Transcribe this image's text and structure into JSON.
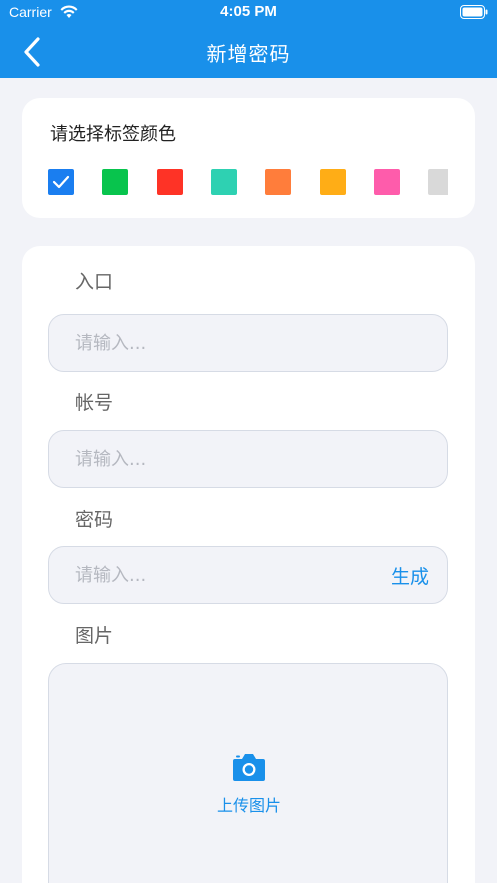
{
  "status_bar": {
    "carrier": "Carrier",
    "time": "4:05 PM"
  },
  "nav": {
    "title": "新增密码"
  },
  "color_picker": {
    "heading": "请选择标签颜色",
    "swatches": [
      {
        "color": "#1a7ef0",
        "selected": true
      },
      {
        "color": "#08c44d",
        "selected": false
      },
      {
        "color": "#fe3326",
        "selected": false
      },
      {
        "color": "#2ed1b2",
        "selected": false
      },
      {
        "color": "#ff7d3b",
        "selected": false
      },
      {
        "color": "#ffad16",
        "selected": false
      },
      {
        "color": "#fe5cab",
        "selected": false
      },
      {
        "color": "#d9d9d9",
        "selected": false
      }
    ]
  },
  "form": {
    "entry_label": "入口",
    "entry_placeholder": "请输入...",
    "account_label": "帐号",
    "account_placeholder": "请输入...",
    "password_label": "密码",
    "password_placeholder": "请输入...",
    "generate_label": "生成",
    "image_label": "图片",
    "upload_label": "上传图片"
  },
  "colors": {
    "primary": "#1990ea",
    "background": "#f2f3f8"
  }
}
